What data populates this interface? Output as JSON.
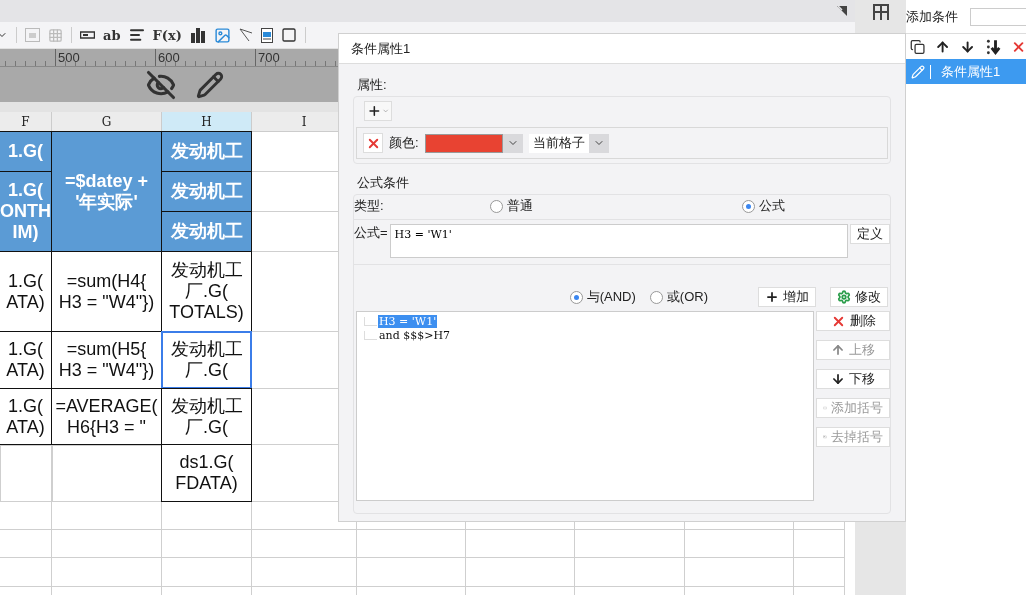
{
  "toolbar": {
    "text_tools": [
      "ab",
      "F(x)"
    ]
  },
  "ruler": {
    "marks": [
      "500",
      "600",
      "700"
    ]
  },
  "sheet": {
    "columns": [
      {
        "label": "F",
        "selected": false
      },
      {
        "label": "G",
        "selected": false
      },
      {
        "label": "H",
        "selected": true
      },
      {
        "label": "I",
        "selected": false
      }
    ],
    "rows": [
      {
        "cells": [
          {
            "kind": "header",
            "text": "1.G(",
            "selected": false
          },
          {
            "kind": "header",
            "text": "=$datey +\n'年实际'",
            "rowspan": 3,
            "selected": false
          },
          {
            "kind": "header",
            "text": "发动机工",
            "selected": false
          }
        ]
      },
      {
        "cells": [
          {
            "kind": "header",
            "text": "1.G(\nONTH\nIM)",
            "rowspan": 2,
            "selected": false
          },
          {
            "kind": "header",
            "text": "发动机工",
            "selected": false
          }
        ]
      },
      {
        "cells": [
          {
            "kind": "header",
            "text": "发动机工",
            "selected": false
          }
        ]
      },
      {
        "cells": [
          {
            "kind": "plain",
            "text": "1.G(\nATA)",
            "selected": false
          },
          {
            "kind": "plain",
            "text": "=sum(H4{\nH3 = \"W4\"})",
            "selected": false
          },
          {
            "kind": "plain",
            "text": "发动机工厂.G(\nTOTALS)",
            "selected": false
          }
        ]
      },
      {
        "cells": [
          {
            "kind": "plain",
            "text": "1.G(\nATA)",
            "selected": false
          },
          {
            "kind": "plain",
            "text": "=sum(H5{\nH3 = \"W4\"})",
            "selected": false
          },
          {
            "kind": "plain",
            "text": "发动机工厂.G(",
            "selected": true
          }
        ]
      },
      {
        "cells": [
          {
            "kind": "plain",
            "text": "1.G(\nATA)",
            "selected": false
          },
          {
            "kind": "plain",
            "text": "=AVERAGE(\nH6{H3 = \"",
            "selected": false
          },
          {
            "kind": "plain",
            "text": "发动机工厂.G(",
            "selected": false
          }
        ]
      },
      {
        "cells": [
          {
            "kind": "blank",
            "selected": false
          },
          {
            "kind": "blank",
            "selected": false
          },
          {
            "kind": "plain",
            "text": "ds1.G(\nFDATA)",
            "selected": false
          }
        ]
      }
    ]
  },
  "dialog": {
    "title": "条件属性1",
    "attributes": {
      "label": "属性:",
      "color_label": "颜色:",
      "color": "#e84332",
      "scope": "当前格子"
    },
    "formula_condition": {
      "label": "公式条件",
      "type_label": "类型:",
      "types": [
        {
          "label": "普通",
          "selected": false
        },
        {
          "label": "公式",
          "selected": true
        }
      ],
      "formula_label": "公式=",
      "formula_value": "H3 = 'W1'",
      "define_button": "定义",
      "joins": [
        {
          "label": "与(AND)",
          "selected": true
        },
        {
          "label": "或(OR)",
          "selected": false
        }
      ],
      "add_button": "增加",
      "modify_button": "修改",
      "conditions": [
        {
          "text": "H3 = 'W1'",
          "selected": true
        },
        {
          "text": "and $$$>H7",
          "selected": false
        }
      ],
      "actions": [
        {
          "kind": "delete",
          "label": "删除",
          "disabled": false
        },
        {
          "kind": "up",
          "label": "上移",
          "disabled": true
        },
        {
          "kind": "down",
          "label": "下移",
          "disabled": false
        },
        {
          "kind": "add_paren",
          "label": "添加括号",
          "disabled": true
        },
        {
          "kind": "remove_paren",
          "label": "去掉括号",
          "disabled": true
        }
      ]
    }
  },
  "side_panel": {
    "add_label": "添加条件",
    "items": [
      {
        "text": "条件属性1",
        "selected": true
      }
    ]
  }
}
